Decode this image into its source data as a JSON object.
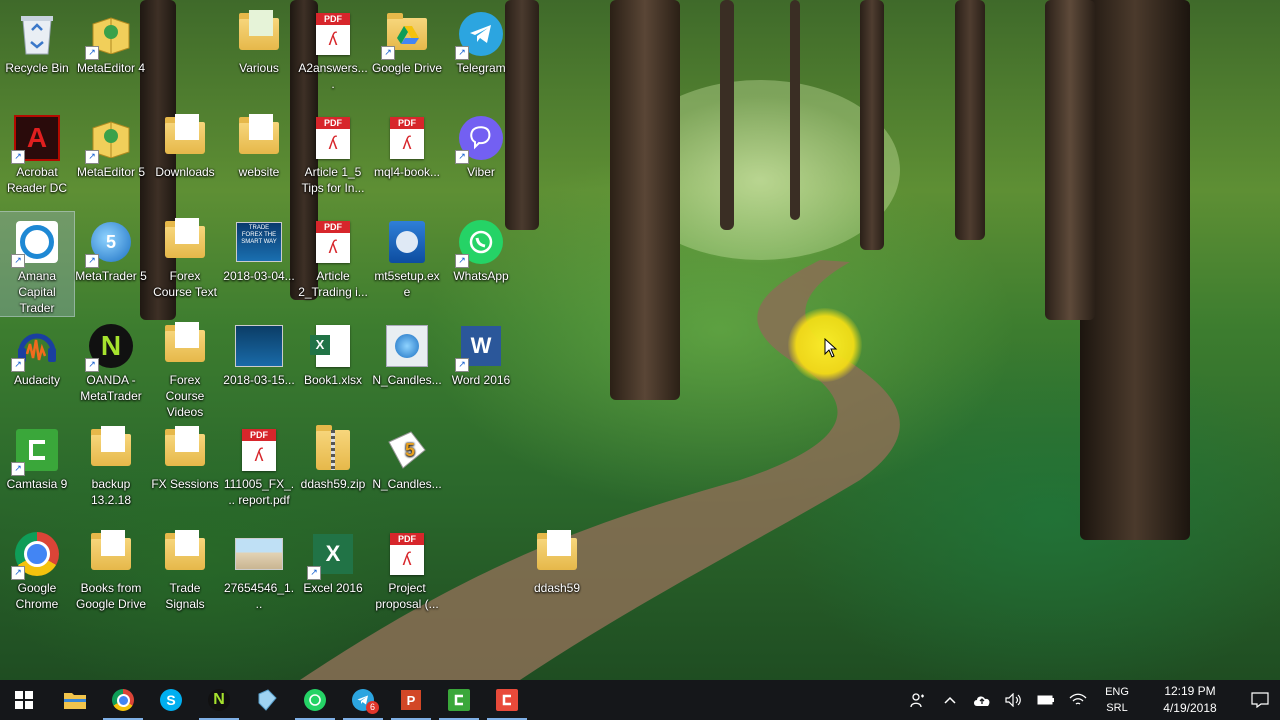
{
  "desktop": {
    "icons": [
      {
        "label": "Recycle Bin"
      },
      {
        "label": "MetaEditor 4"
      },
      {
        "label": "Various"
      },
      {
        "label": "A2answers...."
      },
      {
        "label": "Google Drive"
      },
      {
        "label": "Telegram"
      },
      {
        "label": "Acrobat Reader DC"
      },
      {
        "label": "MetaEditor 5"
      },
      {
        "label": "Downloads"
      },
      {
        "label": "website"
      },
      {
        "label": "Article 1_5 Tips for In..."
      },
      {
        "label": "mql4-book..."
      },
      {
        "label": "Viber"
      },
      {
        "label": "Amana Capital Trader"
      },
      {
        "label": "MetaTrader 5"
      },
      {
        "label": "Forex Course Text"
      },
      {
        "label": "2018-03-04..."
      },
      {
        "label": "Article 2_Trading i..."
      },
      {
        "label": "mt5setup.exe"
      },
      {
        "label": "WhatsApp"
      },
      {
        "label": "Audacity"
      },
      {
        "label": "OANDA - MetaTrader"
      },
      {
        "label": "Forex Course Videos"
      },
      {
        "label": "2018-03-15..."
      },
      {
        "label": "Book1.xlsx"
      },
      {
        "label": "N_Candles..."
      },
      {
        "label": "Word 2016"
      },
      {
        "label": "Camtasia 9"
      },
      {
        "label": "backup 13.2.18"
      },
      {
        "label": "FX Sessions"
      },
      {
        "label": "111005_FX_... report.pdf"
      },
      {
        "label": "ddash59.zip"
      },
      {
        "label": "N_Candles..."
      },
      {
        "label": "Google Chrome"
      },
      {
        "label": "Books from Google Drive"
      },
      {
        "label": "Trade Signals"
      },
      {
        "label": "27654546_1..."
      },
      {
        "label": "Excel 2016"
      },
      {
        "label": "Project proposal (..."
      },
      {
        "label": "ddash59"
      }
    ]
  },
  "icon_text": {
    "pdf_tag": "PDF",
    "excel_letter": "X",
    "word_letter": "W",
    "trade_forex_thumb": "TRADE FOREX THE SMART WAY",
    "mt5_number": "5",
    "oanda_letter": "N"
  },
  "taskbar": {
    "apps": [
      "start-icon",
      "file-explorer-icon",
      "chrome-icon",
      "skype-icon",
      "oanda-icon",
      "metaeditor-icon",
      "whatsapp-icon",
      "telegram-icon",
      "powerpoint-icon",
      "camtasia-icon",
      "camtasia-recorder-icon"
    ],
    "telegram_badge": "6",
    "language_top": "ENG",
    "language_bottom": "SRL",
    "time": "12:19 PM",
    "date": "4/19/2018"
  },
  "colors": {
    "taskbar": "#15171a",
    "cursor_highlight": "#f7e31c",
    "pdf_red": "#d7262b",
    "telegram": "#2ca5e0",
    "whatsapp": "#25d366",
    "viber": "#7360f2",
    "word": "#2b579a",
    "excel": "#217346",
    "camtasia": "#3aa73a"
  }
}
